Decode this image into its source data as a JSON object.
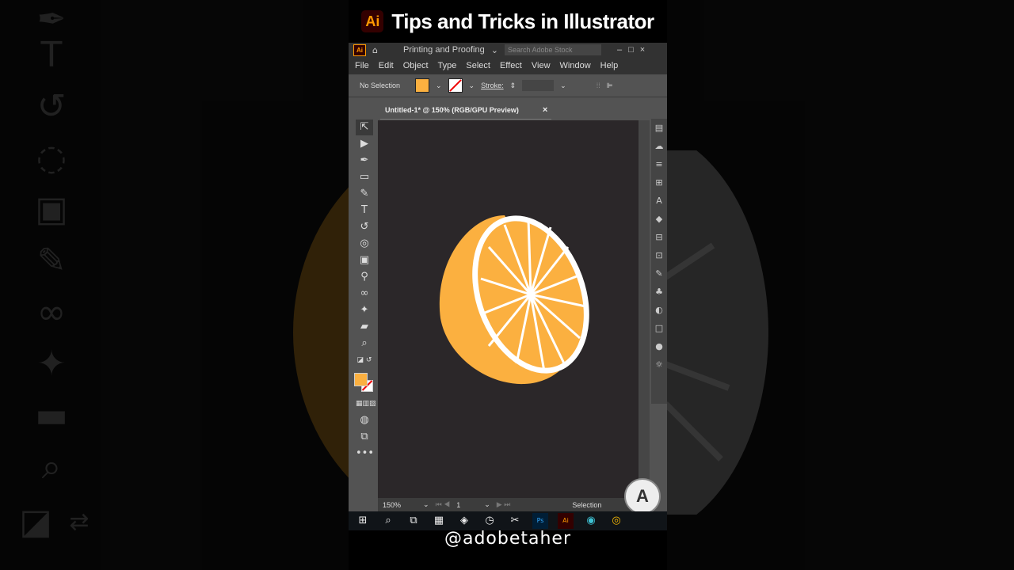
{
  "video": {
    "title": "Tips and Tricks in Illustrator",
    "logo_text": "Ai",
    "handle": "@adobetaher"
  },
  "app": {
    "logo_text": "Ai",
    "workspace": "Printing and Proofing",
    "search_placeholder": "Search Adobe Stock",
    "menu": [
      "File",
      "Edit",
      "Object",
      "Type",
      "Select",
      "Effect",
      "View",
      "Window",
      "Help"
    ],
    "control": {
      "selection": "No Selection",
      "stroke_label": "Stroke:"
    },
    "doc_tab": {
      "label": "Untitled-1* @ 150% (RGB/GPU Preview)",
      "close": "×"
    },
    "status": {
      "zoom": "150%",
      "artboard": "1",
      "tool": "Selection"
    }
  },
  "colors": {
    "fill": "#fbb040",
    "canvas": "#2b2729",
    "rind": "#ffffff"
  },
  "icons": {
    "tools": [
      "selection-icon",
      "direct-selection-icon",
      "pen-icon",
      "rectangle-icon",
      "paintbrush-icon",
      "type-icon",
      "rotate-icon",
      "shape-builder-icon",
      "gradient-icon",
      "eyedropper-icon",
      "blend-icon",
      "pin-icon",
      "eraser-icon",
      "zoom-icon"
    ],
    "taskbar": [
      "windows-start-icon",
      "search-icon",
      "task-view-icon",
      "calculator-icon",
      "app-icon",
      "clock-icon",
      "capcut-icon",
      "photoshop-icon",
      "illustrator-icon",
      "edge-icon",
      "chrome-icon"
    ]
  }
}
